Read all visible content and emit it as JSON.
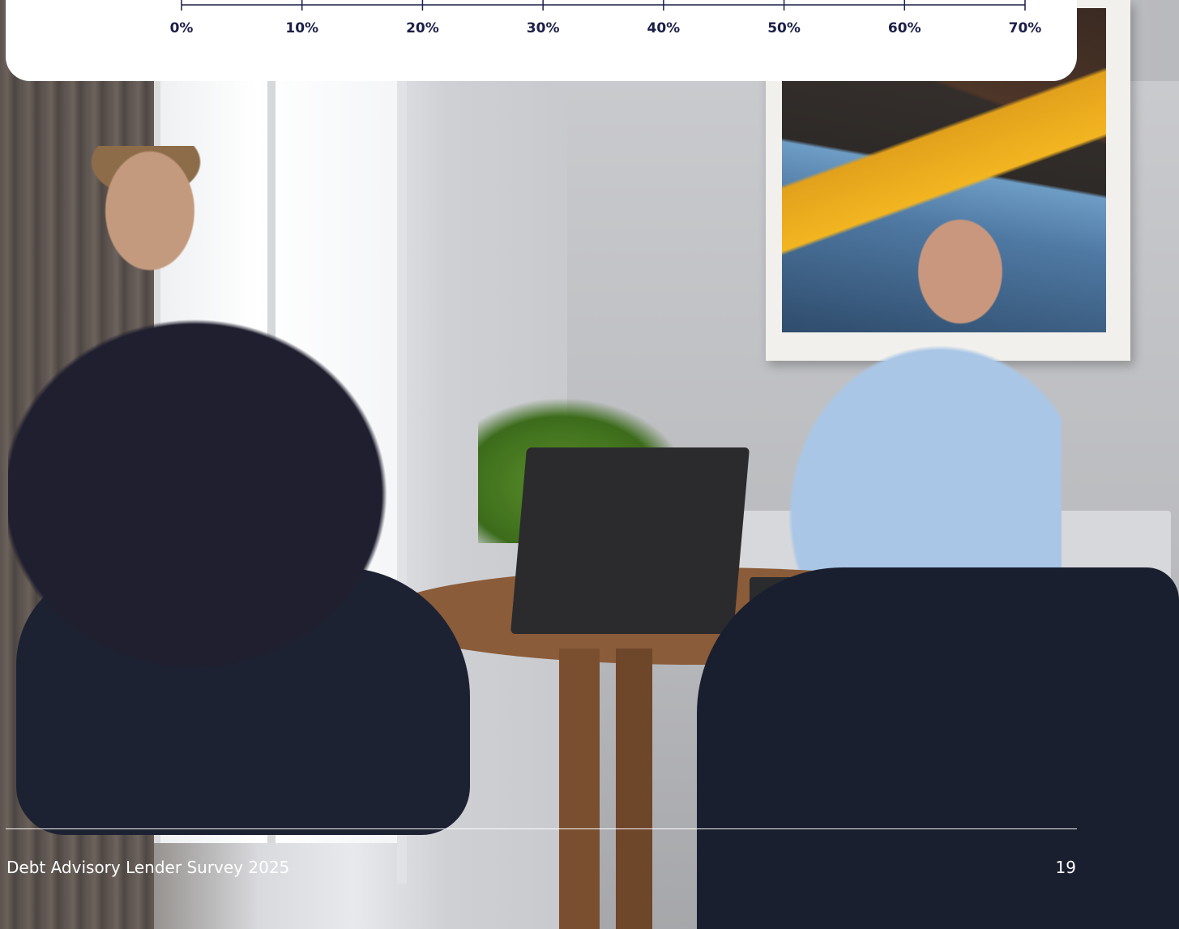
{
  "chart_data": {
    "type": "bar",
    "x_axis": {
      "tick_labels": [
        "0%",
        "10%",
        "20%",
        "30%",
        "40%",
        "50%",
        "60%",
        "70%"
      ],
      "xlim": [
        0,
        70
      ]
    },
    "axis_color": "#1b1f47"
  },
  "footer": {
    "title": "Debt Advisory Lender Survey 2025",
    "page_number": "19"
  },
  "photo": {
    "description_icon": "office-meeting-photo"
  }
}
